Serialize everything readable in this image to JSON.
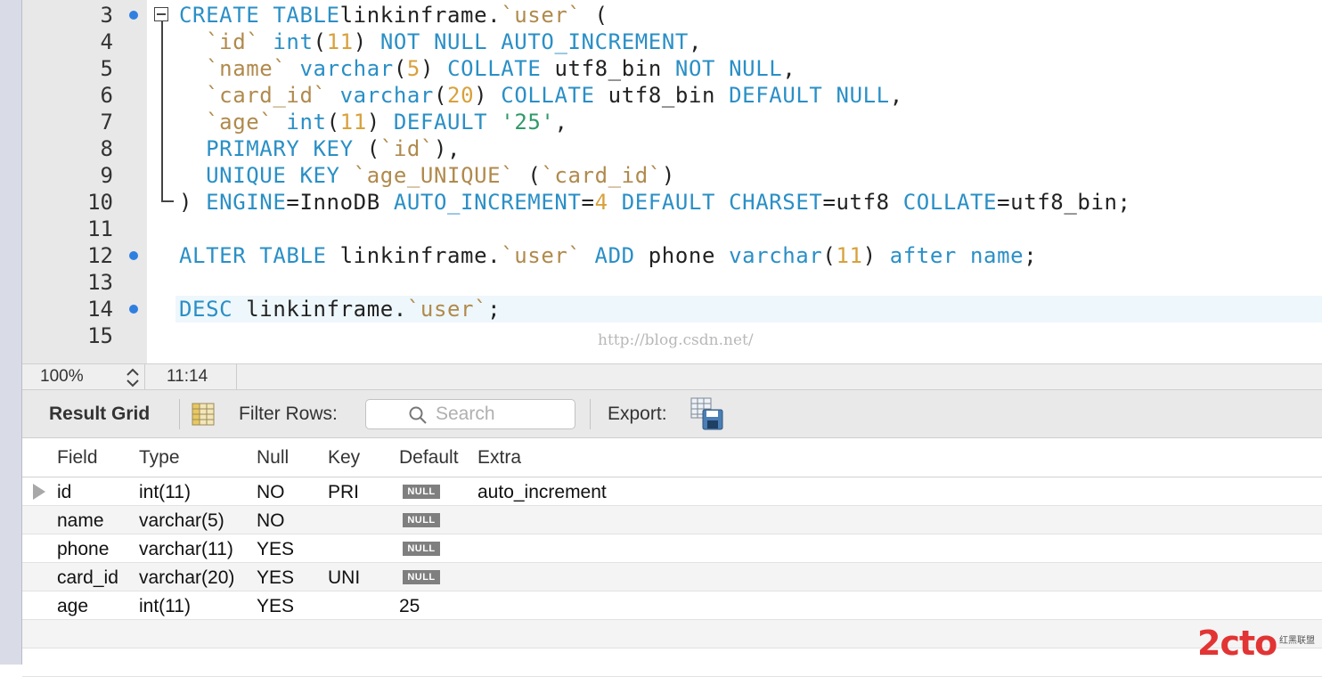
{
  "editor": {
    "lines": [
      {
        "n": "3",
        "dot": true,
        "tokens": [
          [
            "kw",
            "CREATE TABLE"
          ],
          [
            "",
            "linkinframe."
          ],
          [
            "str",
            "`user`"
          ],
          [
            "",
            " ("
          ]
        ]
      },
      {
        "n": "4",
        "dot": false,
        "tokens": [
          [
            "",
            "  "
          ],
          [
            "str",
            "`id`"
          ],
          [
            "",
            " "
          ],
          [
            "kw",
            "int"
          ],
          [
            "",
            "("
          ],
          [
            "num",
            "11"
          ],
          [
            "",
            ") "
          ],
          [
            "kw",
            "NOT NULL AUTO_INCREMENT"
          ],
          [
            "",
            ","
          ]
        ]
      },
      {
        "n": "5",
        "dot": false,
        "tokens": [
          [
            "",
            "  "
          ],
          [
            "str",
            "`name`"
          ],
          [
            "",
            " "
          ],
          [
            "kw",
            "varchar"
          ],
          [
            "",
            "("
          ],
          [
            "num",
            "5"
          ],
          [
            "",
            ") "
          ],
          [
            "kw",
            "COLLATE"
          ],
          [
            "",
            " utf8_bin "
          ],
          [
            "kw",
            "NOT NULL"
          ],
          [
            "",
            ","
          ]
        ]
      },
      {
        "n": "6",
        "dot": false,
        "tokens": [
          [
            "",
            "  "
          ],
          [
            "str",
            "`card_id`"
          ],
          [
            "",
            " "
          ],
          [
            "kw",
            "varchar"
          ],
          [
            "",
            "("
          ],
          [
            "num",
            "20"
          ],
          [
            "",
            ") "
          ],
          [
            "kw",
            "COLLATE"
          ],
          [
            "",
            " utf8_bin "
          ],
          [
            "kw",
            "DEFAULT NULL"
          ],
          [
            "",
            ","
          ]
        ]
      },
      {
        "n": "7",
        "dot": false,
        "tokens": [
          [
            "",
            "  "
          ],
          [
            "str",
            "`age`"
          ],
          [
            "",
            " "
          ],
          [
            "kw",
            "int"
          ],
          [
            "",
            "("
          ],
          [
            "num",
            "11"
          ],
          [
            "",
            ") "
          ],
          [
            "kw",
            "DEFAULT"
          ],
          [
            "",
            " "
          ],
          [
            "sstr",
            "'25'"
          ],
          [
            "",
            ","
          ]
        ]
      },
      {
        "n": "8",
        "dot": false,
        "tokens": [
          [
            "",
            "  "
          ],
          [
            "kw",
            "PRIMARY KEY"
          ],
          [
            "",
            " ("
          ],
          [
            "str",
            "`id`"
          ],
          [
            "",
            "),"
          ]
        ]
      },
      {
        "n": "9",
        "dot": false,
        "tokens": [
          [
            "",
            "  "
          ],
          [
            "kw",
            "UNIQUE KEY"
          ],
          [
            "",
            " "
          ],
          [
            "str",
            "`age_UNIQUE`"
          ],
          [
            "",
            " ("
          ],
          [
            "str",
            "`card_id`"
          ],
          [
            "",
            ")"
          ]
        ]
      },
      {
        "n": "10",
        "dot": false,
        "tokens": [
          [
            "",
            ") "
          ],
          [
            "kw",
            "ENGINE"
          ],
          [
            "",
            "=InnoDB "
          ],
          [
            "kw",
            "AUTO_INCREMENT"
          ],
          [
            "",
            "="
          ],
          [
            "num",
            "4"
          ],
          [
            "",
            " "
          ],
          [
            "kw",
            "DEFAULT CHARSET"
          ],
          [
            "",
            "=utf8 "
          ],
          [
            "kw",
            "COLLATE"
          ],
          [
            "",
            "=utf8_bin;"
          ]
        ]
      },
      {
        "n": "11",
        "dot": false,
        "tokens": []
      },
      {
        "n": "12",
        "dot": true,
        "tokens": [
          [
            "kw",
            "ALTER TABLE"
          ],
          [
            "",
            " linkinframe."
          ],
          [
            "str",
            "`user`"
          ],
          [
            "",
            " "
          ],
          [
            "kw",
            "ADD"
          ],
          [
            "",
            " phone "
          ],
          [
            "kw",
            "varchar"
          ],
          [
            "",
            "("
          ],
          [
            "num",
            "11"
          ],
          [
            "",
            ") "
          ],
          [
            "kw",
            "after name"
          ],
          [
            "",
            ";"
          ]
        ]
      },
      {
        "n": "13",
        "dot": false,
        "tokens": []
      },
      {
        "n": "14",
        "dot": true,
        "tokens": [
          [
            "kw",
            "DESC"
          ],
          [
            "",
            " linkinframe."
          ],
          [
            "str",
            "`user`"
          ],
          [
            "",
            ";"
          ]
        ]
      },
      {
        "n": "15",
        "dot": false,
        "tokens": []
      }
    ],
    "watermark": "http://blog.csdn.net/"
  },
  "status": {
    "zoom": "100%",
    "cursor": "11:14"
  },
  "toolbar": {
    "result_grid": "Result Grid",
    "filter_rows": "Filter Rows:",
    "search_placeholder": "Search",
    "export": "Export:"
  },
  "grid": {
    "columns": [
      "Field",
      "Type",
      "Null",
      "Key",
      "Default",
      "Extra"
    ],
    "null_label": "NULL",
    "rows": [
      {
        "field": "id",
        "type": "int(11)",
        "null": "NO",
        "key": "PRI",
        "default": null,
        "extra": "auto_increment",
        "current": true
      },
      {
        "field": "name",
        "type": "varchar(5)",
        "null": "NO",
        "key": "",
        "default": null,
        "extra": ""
      },
      {
        "field": "phone",
        "type": "varchar(11)",
        "null": "YES",
        "key": "",
        "default": null,
        "extra": ""
      },
      {
        "field": "card_id",
        "type": "varchar(20)",
        "null": "YES",
        "key": "UNI",
        "default": null,
        "extra": ""
      },
      {
        "field": "age",
        "type": "int(11)",
        "null": "YES",
        "key": "",
        "default": "25",
        "extra": ""
      }
    ]
  },
  "logo": {
    "text": "2cto",
    "sub": "红黑联盟"
  }
}
